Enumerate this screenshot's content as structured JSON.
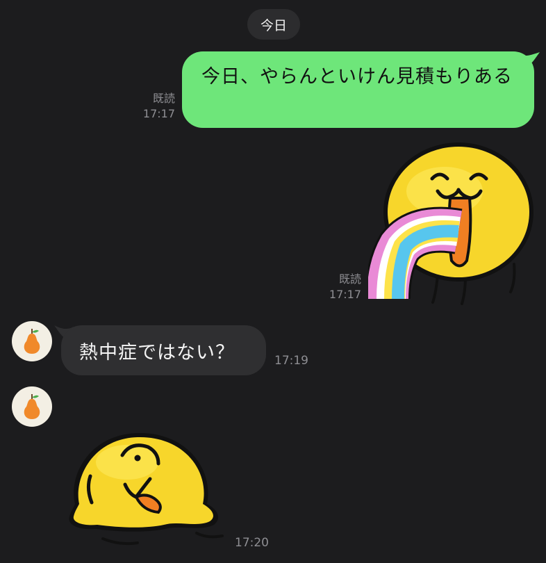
{
  "date_divider": "今日",
  "messages": [
    {
      "id": "m1",
      "direction": "outgoing",
      "type": "text",
      "text": "今日、やらんといけん見積もりある",
      "read_label": "既読",
      "time": "17:17"
    },
    {
      "id": "m2",
      "direction": "outgoing",
      "type": "sticker",
      "sticker": "yellow-blob-rainbow-sticker",
      "read_label": "既読",
      "time": "17:17"
    },
    {
      "id": "m3",
      "direction": "incoming",
      "type": "text",
      "text": "熱中症ではない？",
      "time": "17:19",
      "avatar": "pear-icon"
    },
    {
      "id": "m4",
      "direction": "incoming",
      "type": "sticker",
      "sticker": "melting-yellow-blob-sticker",
      "time": "17:20",
      "avatar": "pear-icon"
    }
  ],
  "colors": {
    "background": "#1c1c1e",
    "outgoing_bubble": "#6ee67a",
    "incoming_bubble": "#2f2f31",
    "meta_text": "#8e8e93",
    "sticker_yellow": "#f7d62b",
    "avatar_bg": "#f3efe4",
    "pear": "#f0892a"
  }
}
